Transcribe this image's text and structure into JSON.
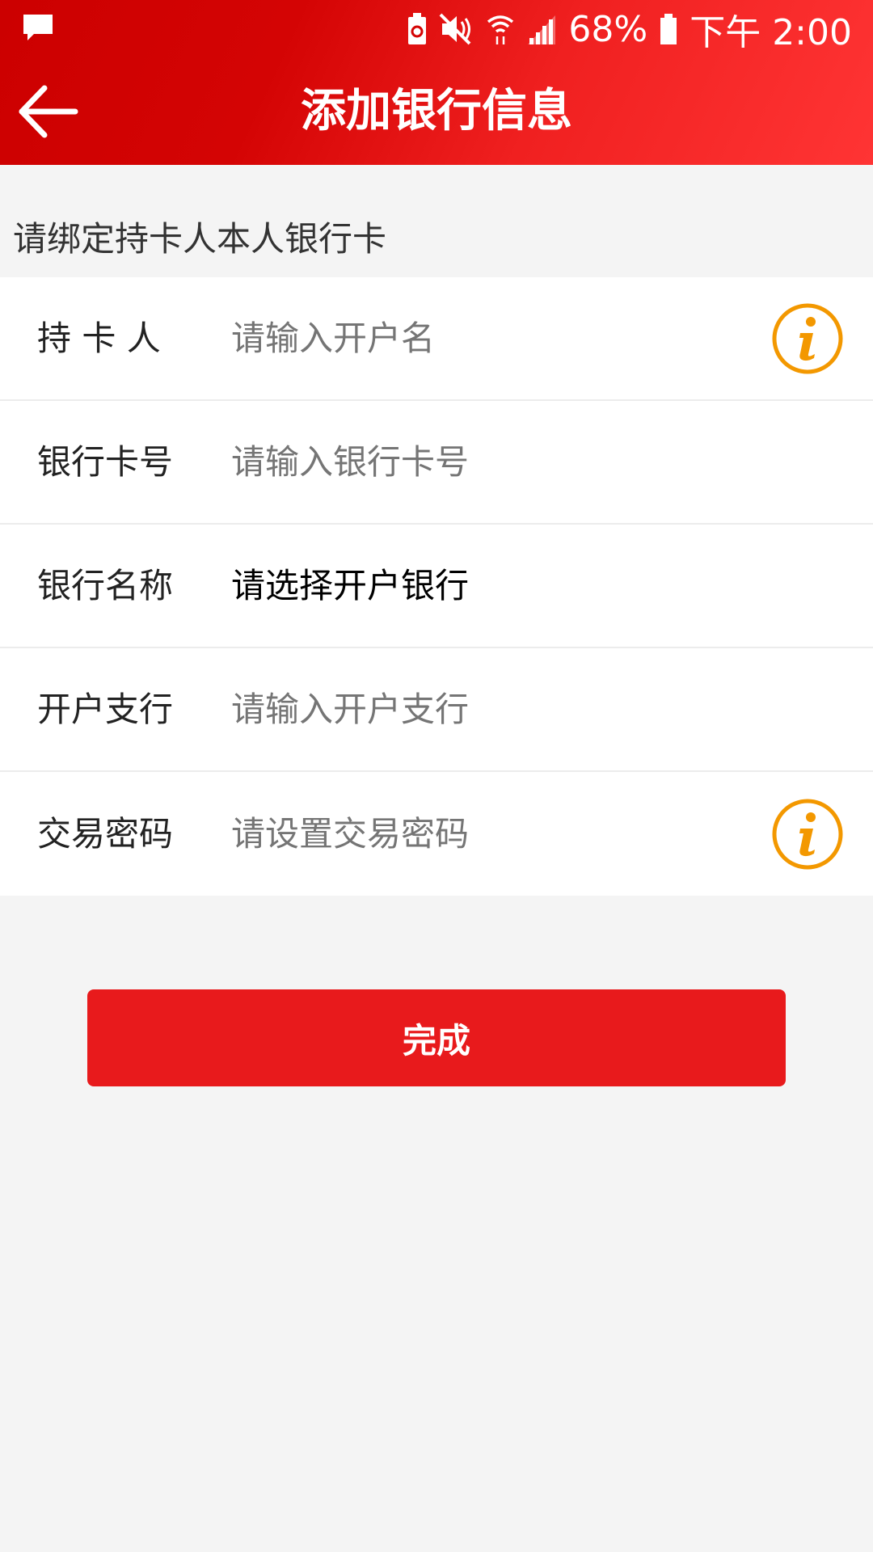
{
  "status_bar": {
    "battery_percent": "68%",
    "time": "下午 2:00"
  },
  "header": {
    "title": "添加银行信息"
  },
  "hint": "请绑定持卡人本人银行卡",
  "form": {
    "rows": [
      {
        "label": "持 卡 人",
        "placeholder": "请输入开户名",
        "has_info": true
      },
      {
        "label": "银行卡号",
        "placeholder": "请输入银行卡号",
        "has_info": false
      },
      {
        "label": "银行名称",
        "value": "请选择开户银行",
        "has_info": false
      },
      {
        "label": "开户支行",
        "placeholder": "请输入开户支行",
        "has_info": false
      },
      {
        "label": "交易密码",
        "placeholder": "请设置交易密码",
        "has_info": true
      }
    ]
  },
  "submit_label": "完成",
  "colors": {
    "header_start": "#cc0000",
    "header_end": "#ff3434",
    "button": "#e81a1c",
    "info_icon": "#f39800",
    "background": "#f4f4f4"
  },
  "icons": {
    "status_left": "message-icon",
    "status_right": [
      "battery-saver-icon",
      "mute-icon",
      "wifi-icon",
      "signal-icon",
      "battery-icon"
    ],
    "back": "back-arrow-icon",
    "info": "info-icon"
  }
}
